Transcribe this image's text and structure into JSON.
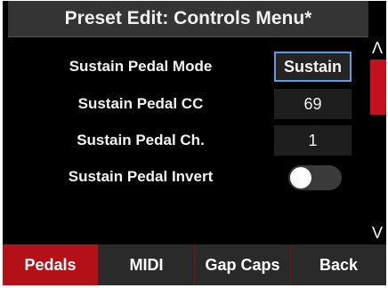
{
  "header": {
    "title": "Preset Edit: Controls Menu*"
  },
  "rows": [
    {
      "label": "Sustain Pedal Mode",
      "value": "Sustain",
      "selected": true
    },
    {
      "label": "Sustain Pedal CC",
      "value": "69"
    },
    {
      "label": "Sustain Pedal Ch.",
      "value": "1"
    },
    {
      "label": "Sustain Pedal Invert",
      "toggle_state": "off"
    }
  ],
  "scrollbar": {
    "up_glyph": "Λ",
    "down_glyph": "V"
  },
  "tabs": [
    {
      "label": "Pedals",
      "active": true
    },
    {
      "label": "MIDI"
    },
    {
      "label": "Gap Caps"
    },
    {
      "label": "Back"
    }
  ],
  "colors": {
    "accent_red": "#b31018",
    "selection_blue": "#5f9de0",
    "title_bar": "#343434",
    "background": "#000000"
  }
}
